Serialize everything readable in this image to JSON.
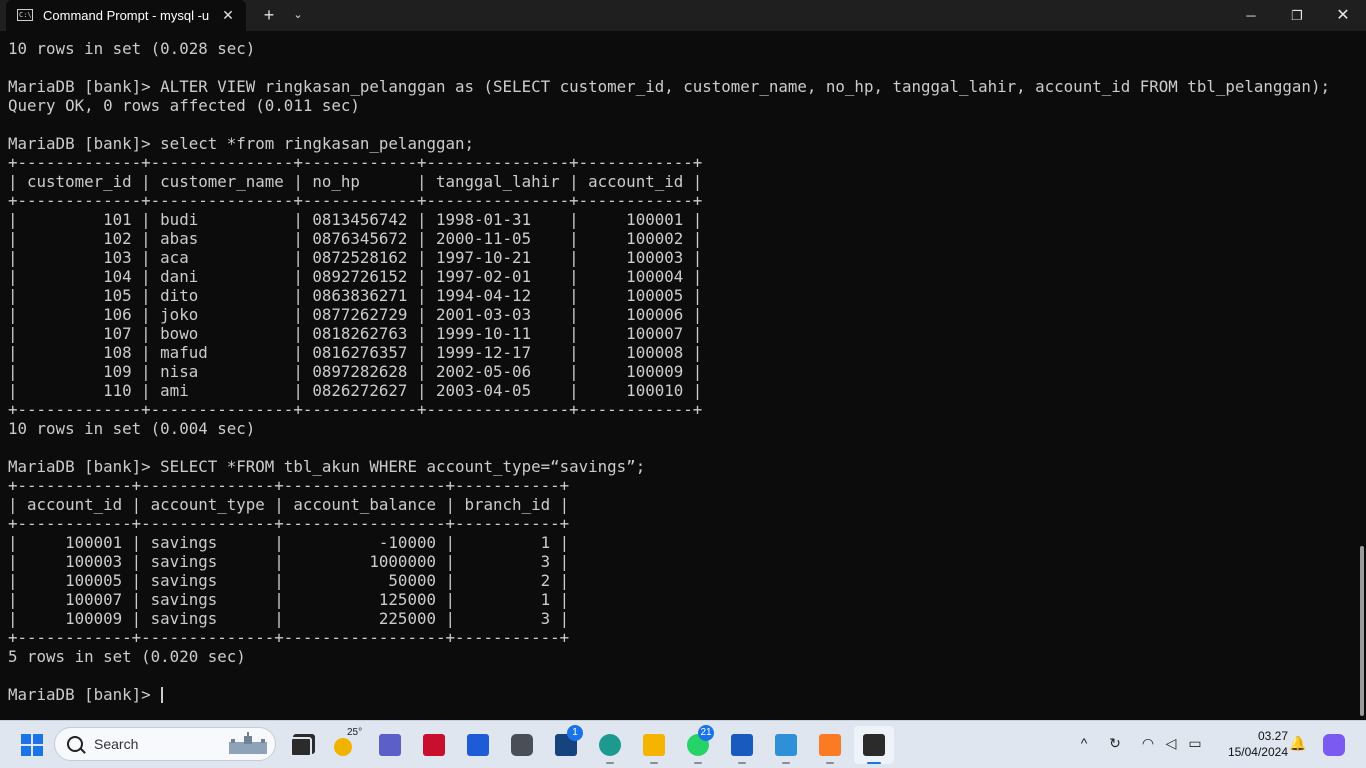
{
  "window": {
    "tab_title": "Command Prompt - mysql  -u",
    "tab_icon_text": "C:\\",
    "close_tab_glyph": "✕",
    "new_tab_glyph": "+",
    "dropdown_glyph": "⌄",
    "minimize_glyph": "─",
    "maximize_glyph": "❐",
    "close_glyph": "✕"
  },
  "terminal": {
    "lines": [
      "10 rows in set (0.028 sec)",
      "",
      "MariaDB [bank]> ALTER VIEW ringkasan_pelanggan as (SELECT customer_id, customer_name, no_hp, tanggal_lahir, account_id FROM tbl_pelanggan);",
      "Query OK, 0 rows affected (0.011 sec)",
      "",
      "MariaDB [bank]> select *from ringkasan_pelanggan;",
      "+-------------+---------------+------------+---------------+------------+",
      "| customer_id | customer_name | no_hp      | tanggal_lahir | account_id |",
      "+-------------+---------------+------------+---------------+------------+",
      "|         101 | budi          | 0813456742 | 1998-01-31    |     100001 |",
      "|         102 | abas          | 0876345672 | 2000-11-05    |     100002 |",
      "|         103 | aca           | 0872528162 | 1997-10-21    |     100003 |",
      "|         104 | dani          | 0892726152 | 1997-02-01    |     100004 |",
      "|         105 | dito          | 0863836271 | 1994-04-12    |     100005 |",
      "|         106 | joko          | 0877262729 | 2001-03-03    |     100006 |",
      "|         107 | bowo          | 0818262763 | 1999-10-11    |     100007 |",
      "|         108 | mafud         | 0816276357 | 1999-12-17    |     100008 |",
      "|         109 | nisa          | 0897282628 | 2002-05-06    |     100009 |",
      "|         110 | ami           | 0826272627 | 2003-04-05    |     100010 |",
      "+-------------+---------------+------------+---------------+------------+",
      "10 rows in set (0.004 sec)",
      "",
      "MariaDB [bank]> SELECT *FROM tbl_akun WHERE account_type=“savings”;",
      "+------------+--------------+-----------------+-----------+",
      "| account_id | account_type | account_balance | branch_id |",
      "+------------+--------------+-----------------+-----------+",
      "|     100001 | savings      |          -10000 |         1 |",
      "|     100003 | savings      |         1000000 |         3 |",
      "|     100005 | savings      |           50000 |         2 |",
      "|     100007 | savings      |          125000 |         1 |",
      "|     100009 | savings      |          225000 |         3 |",
      "+------------+--------------+-----------------+-----------+",
      "5 rows in set (0.020 sec)",
      ""
    ],
    "prompt": "MariaDB [bank]> "
  },
  "taskbar": {
    "search_label": "Search",
    "weather_temp": "25°",
    "badges": {
      "l_app": "1",
      "whatsapp": "21"
    },
    "clock_time": "03.27",
    "clock_date": "15/04/2024"
  },
  "colors": {
    "terminal_bg": "#0c0c0c",
    "terminal_fg": "#cccccc",
    "titlebar_bg": "#1f1f1f",
    "taskbar_bg": "#dfe6ef",
    "accent": "#1a73e8"
  }
}
